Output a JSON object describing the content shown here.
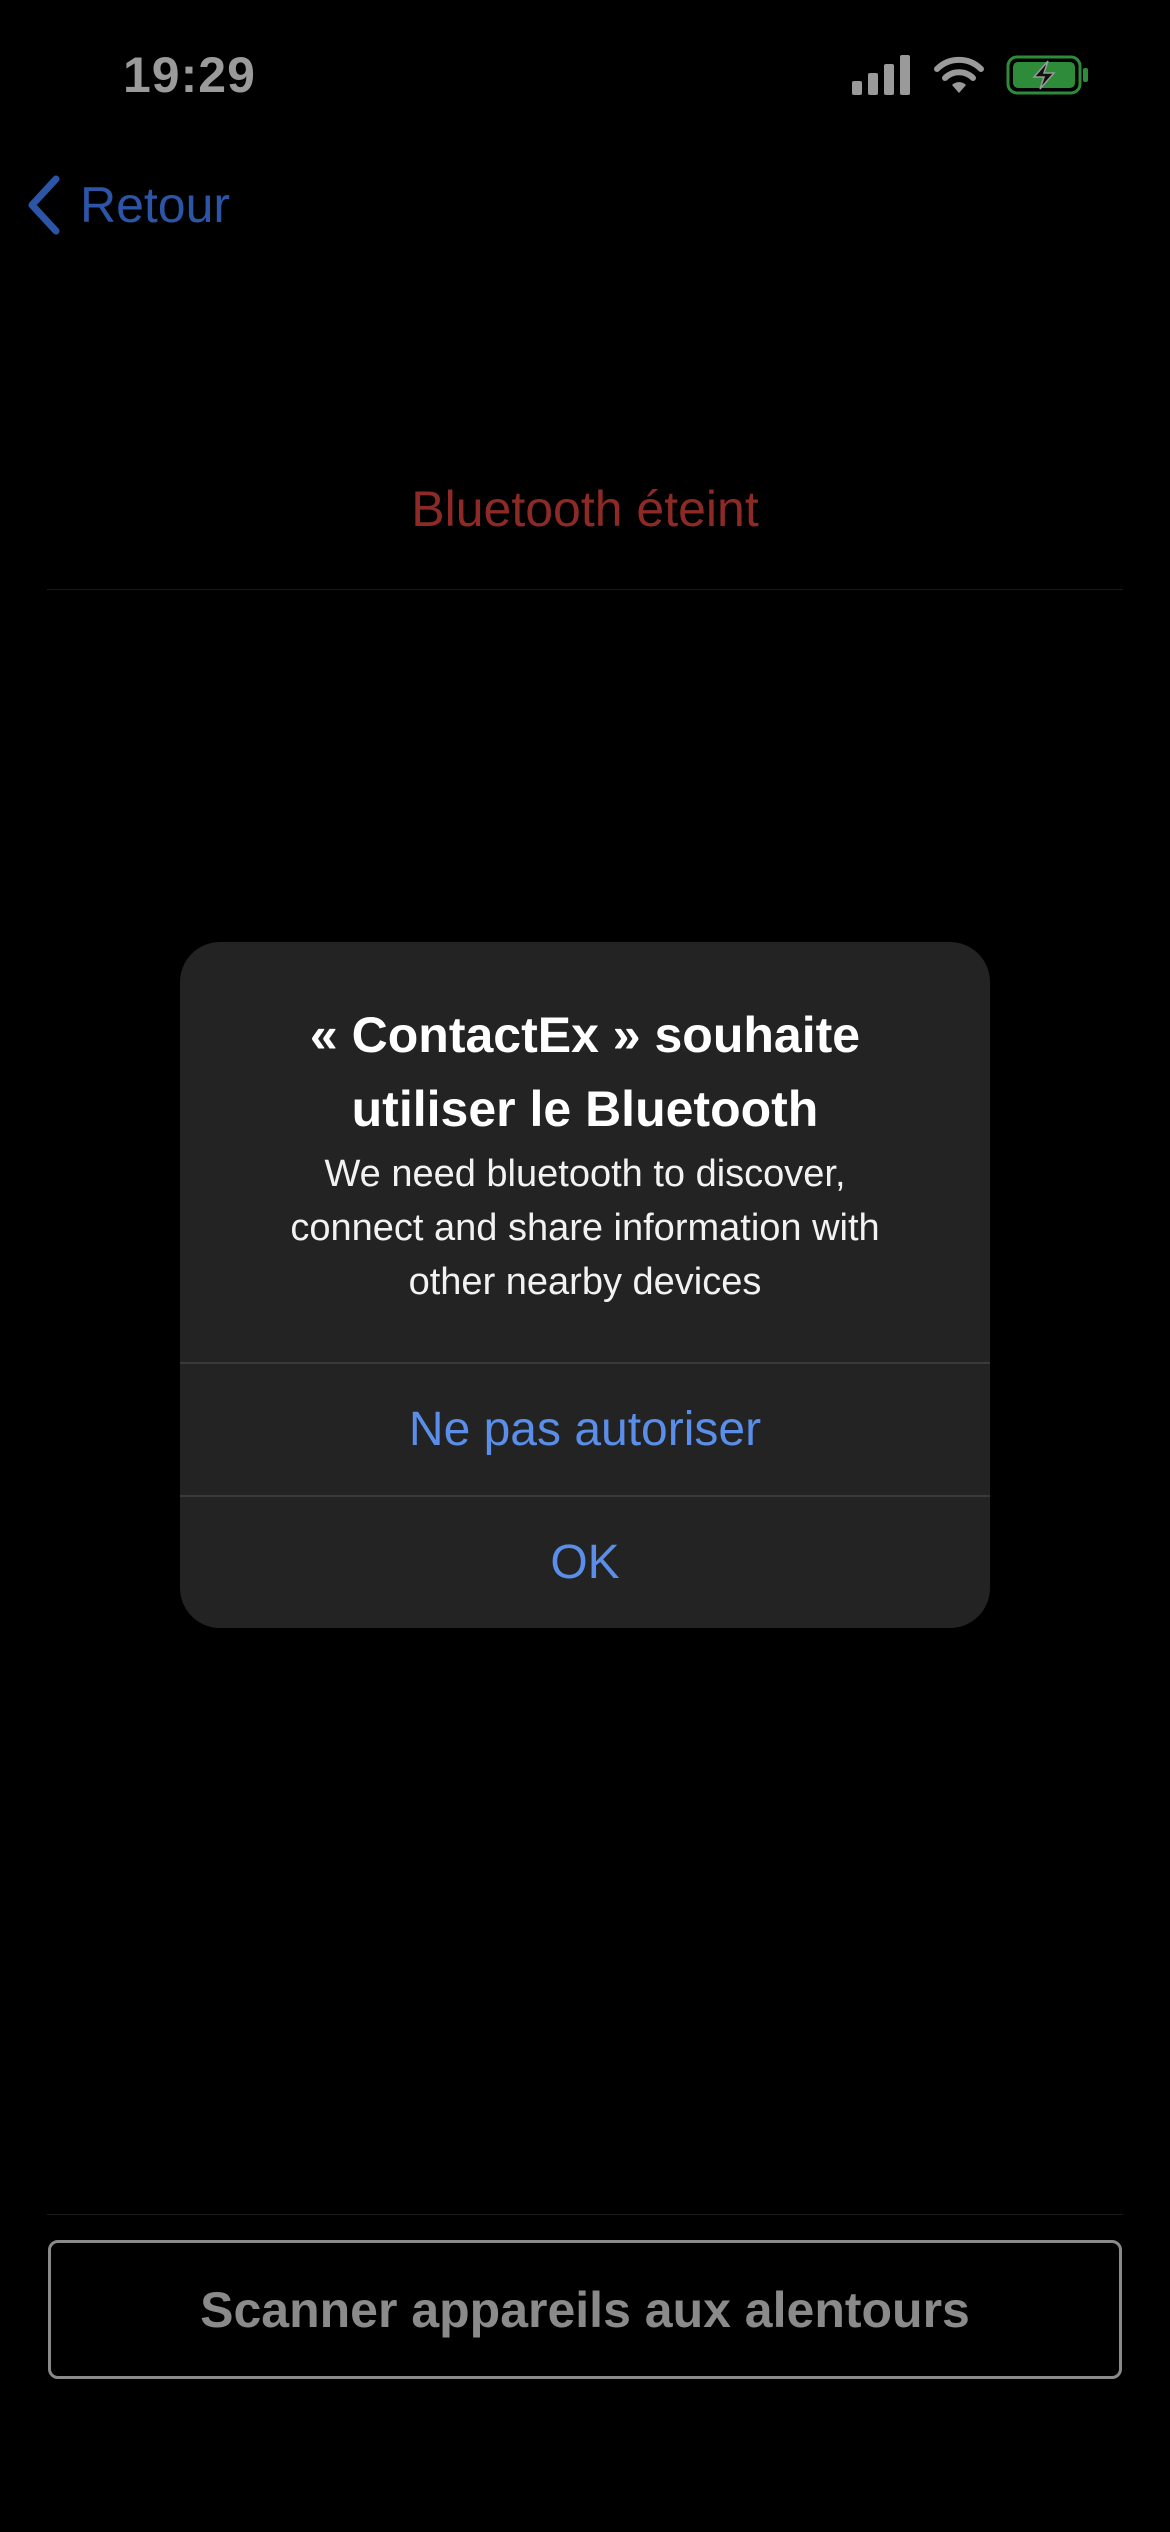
{
  "status_bar": {
    "time": "19:29",
    "icons": [
      "cellular-signal-icon",
      "wifi-icon",
      "battery-charging-icon"
    ]
  },
  "nav": {
    "back_label": "Retour"
  },
  "page": {
    "status_text": "Bluetooth éteint",
    "scan_button_label": "Scanner appareils aux alentours"
  },
  "alert": {
    "title_line1": "« ContactEx » souhaite",
    "title_line2": "utiliser le Bluetooth",
    "message_line1": "We need bluetooth to discover,",
    "message_line2": "connect and share information with",
    "message_line3": "other nearby devices",
    "deny_label": "Ne pas autoriser",
    "ok_label": "OK"
  },
  "colors": {
    "background": "#000000",
    "link_blue": "#2c55a8",
    "alert_button_blue": "#5a8ee8",
    "status_error_red": "#8d2a26",
    "battery_green": "#2e8b3a",
    "alert_background": "#232323"
  }
}
